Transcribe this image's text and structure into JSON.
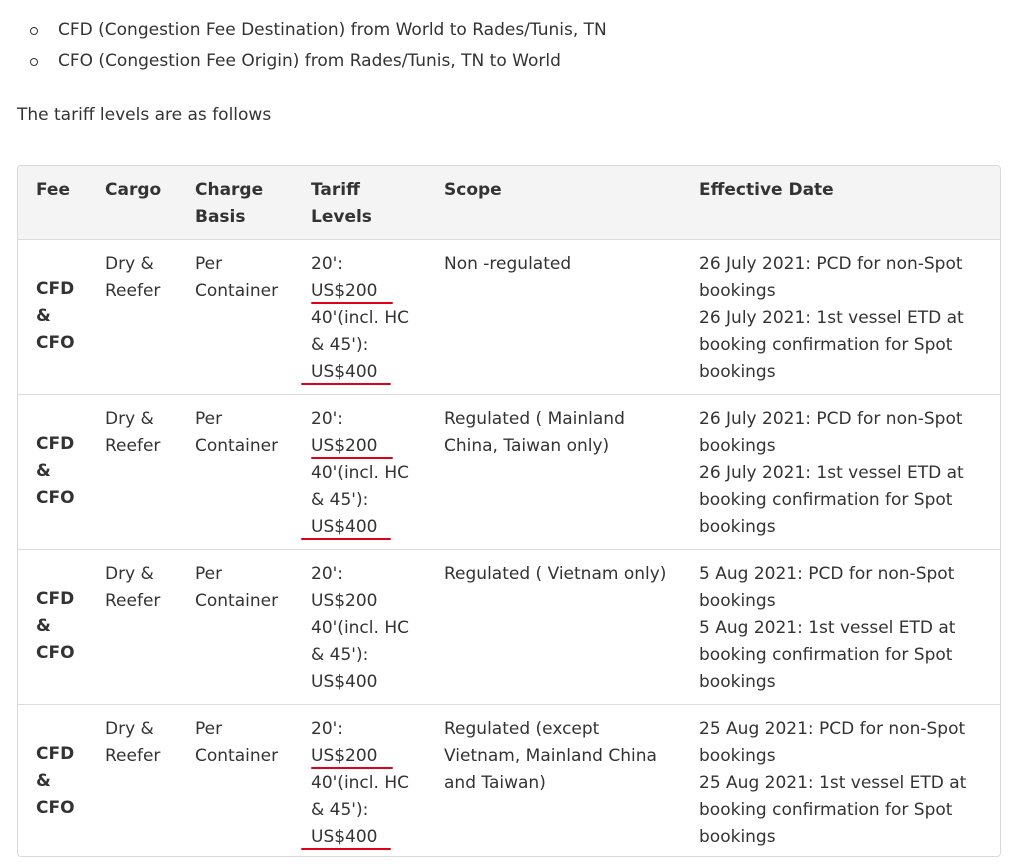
{
  "bullets": [
    "CFD (Congestion Fee Destination) from World to Rades/Tunis, TN",
    "CFO (Congestion Fee Origin) from Rades/Tunis, TN to World"
  ],
  "intro": "The tariff levels are as follows",
  "table": {
    "headers": {
      "fee": "Fee",
      "cargo": "Cargo",
      "charge_basis": [
        "Charge",
        "Basis"
      ],
      "tariff_levels": [
        "Tariff",
        "Levels"
      ],
      "scope": "Scope",
      "effective_date": "Effective Date"
    },
    "rows": [
      {
        "fee": [
          "CFD",
          "&",
          "CFO"
        ],
        "cargo": [
          "Dry &",
          "Reefer"
        ],
        "charge_basis": [
          "Per",
          "Container"
        ],
        "tariff": [
          "20':",
          "US$200",
          "40'(incl. HC",
          "& 45'):",
          "US$400"
        ],
        "scope": [
          "Non -regulated"
        ],
        "effective": [
          "26 July 2021: PCD for non-Spot",
          "bookings",
          "26 July 2021: 1st vessel ETD at",
          "booking confirmation for Spot",
          "bookings"
        ]
      },
      {
        "fee": [
          "CFD",
          "&",
          "CFO"
        ],
        "cargo": [
          "Dry &",
          "Reefer"
        ],
        "charge_basis": [
          "Per",
          "Container"
        ],
        "tariff": [
          "20':",
          "US$200",
          "40'(incl. HC",
          "& 45'):",
          "US$400"
        ],
        "scope": [
          "Regulated ( Mainland",
          "China, Taiwan only)"
        ],
        "effective": [
          "26 July 2021: PCD for non-Spot",
          "bookings",
          "26 July 2021: 1st vessel ETD at",
          "booking confirmation for Spot",
          "bookings"
        ]
      },
      {
        "fee": [
          "CFD",
          "&",
          "CFO"
        ],
        "cargo": [
          "Dry &",
          "Reefer"
        ],
        "charge_basis": [
          "Per",
          "Container"
        ],
        "tariff": [
          "20':",
          "US$200",
          "40'(incl. HC",
          "& 45'):",
          "US$400"
        ],
        "scope": [
          "Regulated ( Vietnam only)"
        ],
        "effective": [
          "5 Aug 2021: PCD for non-Spot",
          "bookings",
          "5 Aug 2021: 1st vessel ETD at",
          "booking confirmation for Spot",
          "bookings"
        ]
      },
      {
        "fee": [
          "CFD",
          "&",
          "CFO"
        ],
        "cargo": [
          "Dry &",
          "Reefer"
        ],
        "charge_basis": [
          "Per",
          "Container"
        ],
        "tariff": [
          "20':",
          "US$200",
          "40'(incl. HC",
          "& 45'):",
          "US$400"
        ],
        "scope": [
          "Regulated (except",
          "Vietnam, Mainland China",
          "and Taiwan)"
        ],
        "effective": [
          "25 Aug 2021: PCD for non-Spot",
          "bookings",
          "25 Aug 2021: 1st vessel ETD at",
          "booking confirmation for Spot",
          "bookings"
        ]
      }
    ]
  },
  "annotations": {
    "underline_color": "#e0001b",
    "underlined_rows": [
      0,
      1,
      3
    ]
  }
}
